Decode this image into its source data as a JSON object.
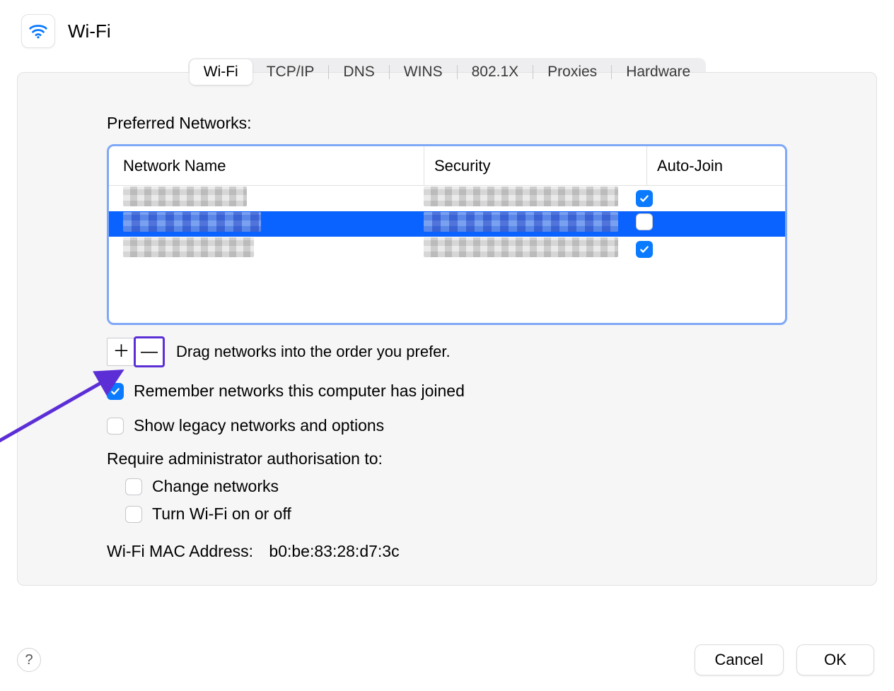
{
  "header": {
    "title": "Wi-Fi"
  },
  "tabs": [
    {
      "label": "Wi-Fi",
      "active": true
    },
    {
      "label": "TCP/IP",
      "active": false
    },
    {
      "label": "DNS",
      "active": false
    },
    {
      "label": "WINS",
      "active": false
    },
    {
      "label": "802.1X",
      "active": false
    },
    {
      "label": "Proxies",
      "active": false
    },
    {
      "label": "Hardware",
      "active": false
    }
  ],
  "section": {
    "preferred_networks_label": "Preferred Networks:",
    "columns": {
      "name": "Network Name",
      "security": "Security",
      "autojoin": "Auto-Join"
    },
    "rows": [
      {
        "selected": false,
        "autojoin": true
      },
      {
        "selected": true,
        "autojoin": false
      },
      {
        "selected": false,
        "autojoin": true
      }
    ],
    "drag_hint": "Drag networks into the order you prefer."
  },
  "options": {
    "remember": {
      "label": "Remember networks this computer has joined",
      "checked": true
    },
    "legacy": {
      "label": "Show legacy networks and options",
      "checked": false
    },
    "admin_label": "Require administrator authorisation to:",
    "admin_change": {
      "label": "Change networks",
      "checked": false
    },
    "admin_toggle": {
      "label": "Turn Wi-Fi on or off",
      "checked": false
    }
  },
  "mac": {
    "label": "Wi-Fi MAC Address:",
    "value": "b0:be:83:28:d7:3c"
  },
  "buttons": {
    "help": "?",
    "cancel": "Cancel",
    "ok": "OK"
  },
  "icons": {
    "plus": "＋",
    "minus": "—"
  }
}
